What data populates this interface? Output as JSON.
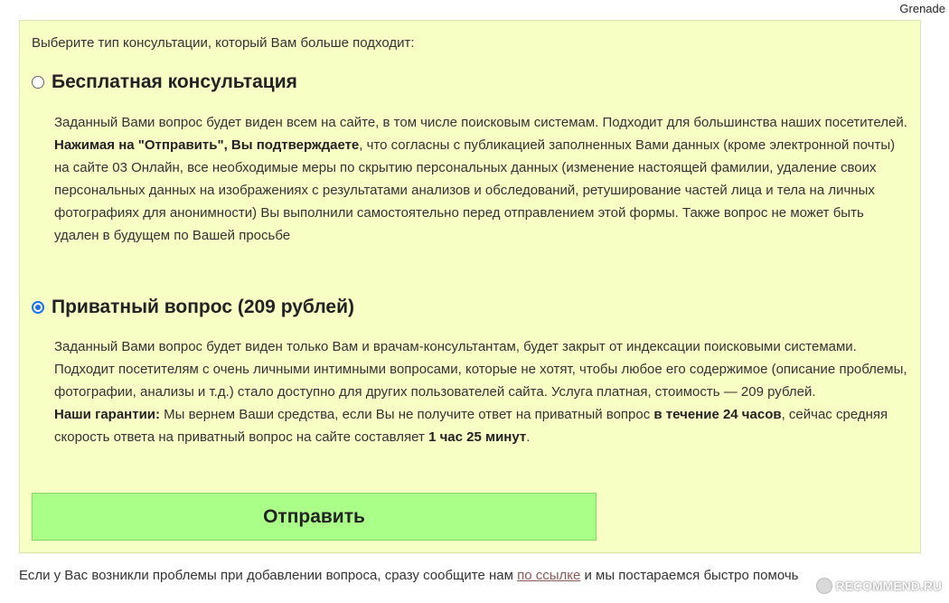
{
  "corner_label": "Grenade",
  "intro": "Выберите тип консультации, который Вам больше подходит:",
  "options": [
    {
      "title": "Бесплатная консультация",
      "checked": false,
      "p1": "Заданный Вами вопрос будет виден всем на сайте, в том числе поисковым системам. Подходит для большинства наших посетителей.",
      "p2_bold": "Нажимая на \"Отправить\", Вы подтверждаете",
      "p2_rest": ", что согласны с публикацией заполненных Вами данных (кроме электронной почты) на сайте 03 Онлайн, все необходимые меры по скрытию персональных данных (изменение настоящей фамилии, удаление своих персональных данных на изображениях с результатами анализов и обследований, ретуширование частей лица и тела на личных фотографиях для анонимности) Вы выполнили самостоятельно перед отправлением этой формы. Также вопрос не может быть удален в будущем по Вашей просьбе"
    },
    {
      "title": "Приватный вопрос (209 рублей)",
      "checked": true,
      "p1": "Заданный Вами вопрос будет виден только Вам и врачам-консультантам, будет закрыт от индексации поисковыми системами. Подходит посетителям с очень личными интимными вопросами, которые не хотят, чтобы любое его содержимое (описание проблемы, фотографии, анализы и т.д.) стало доступно для других пользователей сайта. Услуга платная, стоимость — 209 рублей.",
      "guarantee_label": "Наши гарантии:",
      "guarantee_text1": " Мы вернем Ваши средства, если Вы не получите ответ на приватный вопрос ",
      "guarantee_bold1": "в течение 24 часов",
      "guarantee_text2": ", сейчас средняя скорость ответа на приватный вопрос на сайте составляет ",
      "guarantee_bold2": "1 час 25 минут",
      "guarantee_end": "."
    }
  ],
  "submit_label": "Отправить",
  "footer": {
    "before": "Если у Вас возникли проблемы при добавлении вопроса, сразу сообщите нам ",
    "link": "по ссылке",
    "after": " и мы постараемся быстро помочь"
  },
  "watermark": "RECOMMEND.RU"
}
